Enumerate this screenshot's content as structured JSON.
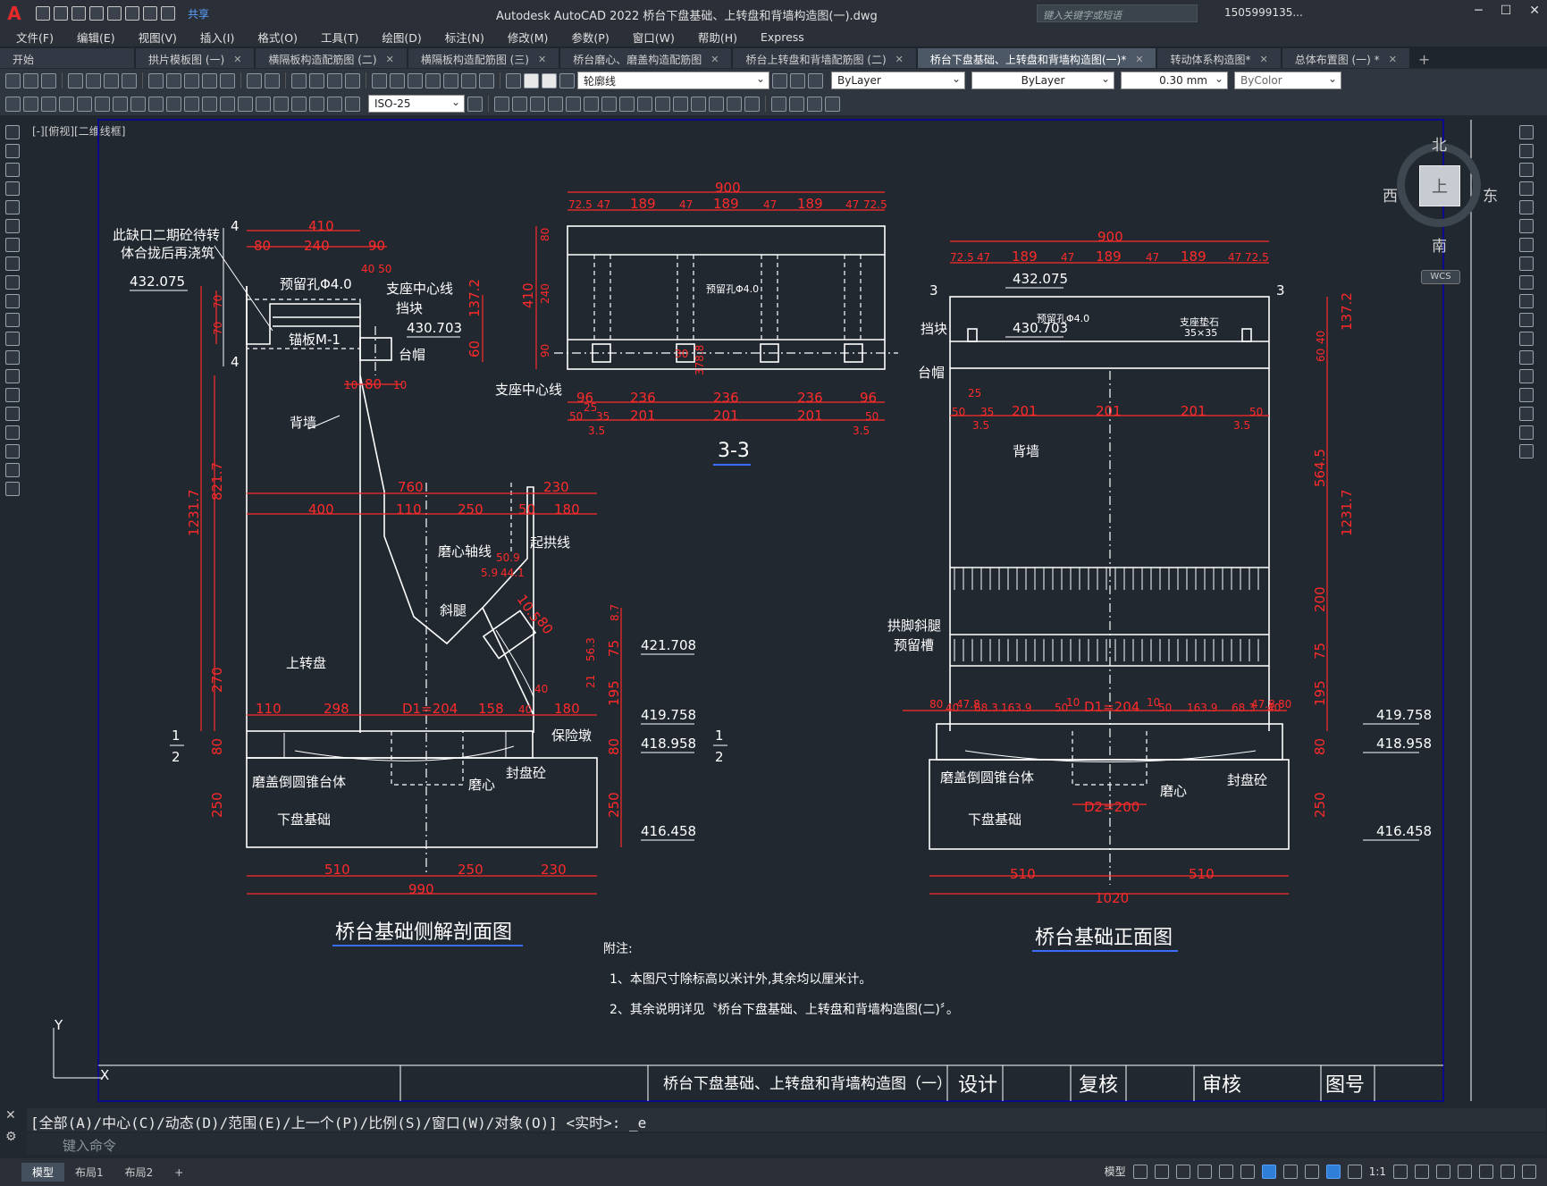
{
  "app": {
    "title": "Autodesk AutoCAD 2022    桥台下盘基础、上转盘和背墙构造图(一).dwg",
    "search_placeholder": "键入关键字或短语",
    "user": "1505999135...",
    "share": "共享",
    "logo": "A"
  },
  "menu": [
    "文件(F)",
    "编辑(E)",
    "视图(V)",
    "插入(I)",
    "格式(O)",
    "工具(T)",
    "绘图(D)",
    "标注(N)",
    "修改(M)",
    "参数(P)",
    "窗口(W)",
    "帮助(H)",
    "Express"
  ],
  "tabs": [
    {
      "label": "开始",
      "active": false
    },
    {
      "label": "拱片模板图 (一)",
      "active": false
    },
    {
      "label": "横隔板构造配筋图 (二)",
      "active": false
    },
    {
      "label": "横隔板构造配筋图 (三)",
      "active": false
    },
    {
      "label": "桥台磨心、磨盖构造配筋图",
      "active": false
    },
    {
      "label": "桥台上转盘和背墙配筋图 (二)",
      "active": false
    },
    {
      "label": "桥台下盘基础、上转盘和背墙构造图(一)*",
      "active": true
    },
    {
      "label": "转动体系构造图*",
      "active": false
    },
    {
      "label": "总体布置图 (一) *",
      "active": false
    }
  ],
  "toolbar": {
    "layer": "轮廓线",
    "color": "ByLayer",
    "linetype": "ByLayer",
    "lineweight": "0.30 mm",
    "plotstyle": "ByColor",
    "dimstyle": "ISO-25"
  },
  "viewport": {
    "label": "[-][俯视][二维线框]",
    "north": "北",
    "south": "南",
    "east": "东",
    "west": "西",
    "face": "上",
    "wcs": "WCS"
  },
  "drawing": {
    "left_title": "桥台基础侧解剖面图",
    "right_title": "桥台基础正面图",
    "section_title": "3-3",
    "notes_heading": "附注:",
    "note1": "1、本图尺寸除标高以米计外,其余均以厘米计。",
    "note2": "2、其余说明详见〝桥台下盘基础、上转盘和背墙构造图(二)〞。",
    "tb_title": "桥台下盘基础、上转盘和背墙构造图（一）",
    "tb_design": "设计",
    "tb_check": "复核",
    "tb_review": "审核",
    "tb_drawno": "图号",
    "left_labels": {
      "note_gap1": "此缺口二期砼待转",
      "note_gap2": "体合拢后再浇筑",
      "hole": "预留孔Φ4.0",
      "anchor": "锚板M-1",
      "bearing_cl": "支座中心线",
      "block": "挡块",
      "cap": "台帽",
      "backwall": "背墙",
      "upper_disc": "上转盘",
      "center_axis": "磨心轴线",
      "arch_line": "起拱线",
      "slope_leg": "斜腿",
      "guard_pier": "保险墩",
      "grind_cover": "磨盖倒圆锥台体",
      "grind_core": "磨心",
      "seal": "封盘砼",
      "lower_found": "下盘基础",
      "bearing_cl2": "支座中心线",
      "sec3_hole": "预留孔Φ4.0"
    },
    "right_labels": {
      "block": "挡块",
      "cap": "台帽",
      "backwall": "背墙",
      "arch_leg1": "拱脚斜腿",
      "arch_leg2": "预留槽",
      "grind_cover": "磨盖倒圆锥台体",
      "grind_core": "磨心",
      "seal": "封盘砼",
      "lower_found": "下盘基础",
      "hole": "预留孔Φ4.0",
      "bearing": "支座垫石",
      "bearing_size": "35×35"
    },
    "elevations": {
      "e432": "432.075",
      "e430": "430.703",
      "e421": "421.708",
      "e419": "419.758",
      "e418": "418.958",
      "e416": "416.458"
    },
    "dims_left": {
      "d410": "410",
      "d80": "80",
      "d240": "240",
      "d90": "90",
      "d4050": "40 50",
      "d70a": "70",
      "d70b": "70",
      "d60": "60",
      "d137": "137.2",
      "d10a": "10",
      "d80b": "80",
      "d10b": "10",
      "d1231": "1231.7",
      "d821": "821.7",
      "d270": "270",
      "d80c": "80",
      "d250": "250",
      "d760": "760",
      "d230": "230",
      "d400": "400",
      "d110": "110",
      "d250b": "250",
      "d50": "50",
      "d180": "180",
      "d110b": "110",
      "d298": "298",
      "dD1": "D1=204",
      "d158": "158",
      "d40": "40",
      "d180b": "180",
      "d510": "510",
      "d250c": "250",
      "d230b": "230",
      "d990": "990",
      "d87": "8.7",
      "d75": "75",
      "d195": "195",
      "d80d": "80",
      "d250d": "250",
      "d563": "56.3",
      "d21": "21",
      "d40b": "40",
      "d509": "50.9",
      "d59": "5.9",
      "d441": "44.1",
      "d105": "10.5",
      "d80e": "80",
      "sec": "1"
    },
    "dims_sec3": {
      "d900": "900",
      "d725a": "72.5",
      "d47a": "47",
      "d189a": "189",
      "d47b": "47",
      "d189b": "189",
      "d47c": "47",
      "d189c": "189",
      "d47d": "47",
      "d725b": "72.5",
      "d80": "80",
      "d410": "410",
      "d240": "240",
      "d90": "90",
      "d96a": "96",
      "d236a": "236",
      "d236b": "236",
      "d236c": "236",
      "d96b": "96",
      "d50a": "50",
      "d201a": "201",
      "d201b": "201",
      "d201c": "201",
      "d50b": "50",
      "d25": "25",
      "d35": "35",
      "d35b": "3.5",
      "d35c": "3.5",
      "d378": "378.8",
      "d30": "30"
    },
    "dims_right": {
      "d900": "900",
      "d725a": "72.5",
      "d47a": "47",
      "d189a": "189",
      "d47b": "47",
      "d189b": "189",
      "d47c": "47",
      "d189c": "189",
      "d47d": "47",
      "d725b": "72.5",
      "d137": "137.2",
      "d40": "40",
      "d60": "60",
      "d564": "564.5",
      "d1231": "1231.7",
      "d200": "200",
      "d75": "75",
      "d195": "195",
      "d80": "80",
      "d250": "250",
      "d50a": "50",
      "d201a": "201",
      "d201b": "201",
      "d201c": "201",
      "d50b": "50",
      "d25a": "25",
      "d35a": "35",
      "d35b": "3.5",
      "d35c": "3.5",
      "d80b": "80",
      "d40b": "40",
      "d478a": "47.8",
      "d683a": "68.3",
      "d1639a": "163.9",
      "d50c": "50",
      "d10a": "10",
      "dD1": "D1=204",
      "d10b": "10",
      "d50d": "50",
      "d1639b": "163.9",
      "d683b": "68.3",
      "d478b": "47.8",
      "d40c": "40",
      "d80c": "80",
      "dD2": "D2=200",
      "d510a": "510",
      "d510b": "510",
      "d1020": "1020"
    }
  },
  "command": {
    "history": "[全部(A)/中心(C)/动态(D)/范围(E)/上一个(P)/比例(S)/窗口(W)/对象(O)] <实时>: _e",
    "placeholder": "键入命令"
  },
  "status": {
    "tabs": [
      "模型",
      "布局1",
      "布局2"
    ],
    "model": "模型",
    "scale": "1:1"
  },
  "colors": {
    "background": "#212830",
    "dim": "#ff2a2a",
    "line": "#ffffff",
    "accent": "#2f7fd8"
  }
}
